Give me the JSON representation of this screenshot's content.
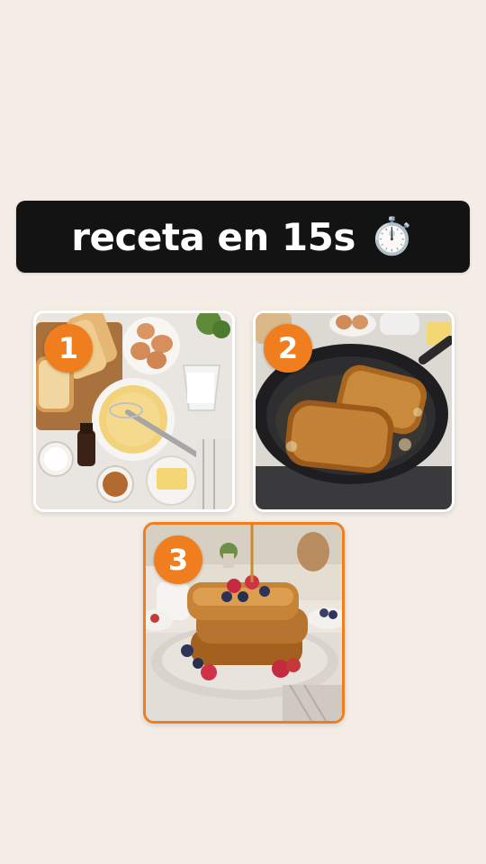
{
  "header": {
    "title": "receta en 15s",
    "emoji": "⏱️",
    "icon": "stopwatch-icon"
  },
  "steps": [
    {
      "number": "1",
      "scene": "ingredients-photo",
      "highlighted": false
    },
    {
      "number": "2",
      "scene": "frying-pan-photo",
      "highlighted": false
    },
    {
      "number": "3",
      "scene": "french-toast-stack-photo",
      "highlighted": true
    }
  ],
  "colors": {
    "background": "#f3ede6",
    "title_bar": "#131313",
    "accent": "#f07d1e",
    "card_border": "#ffffff"
  }
}
